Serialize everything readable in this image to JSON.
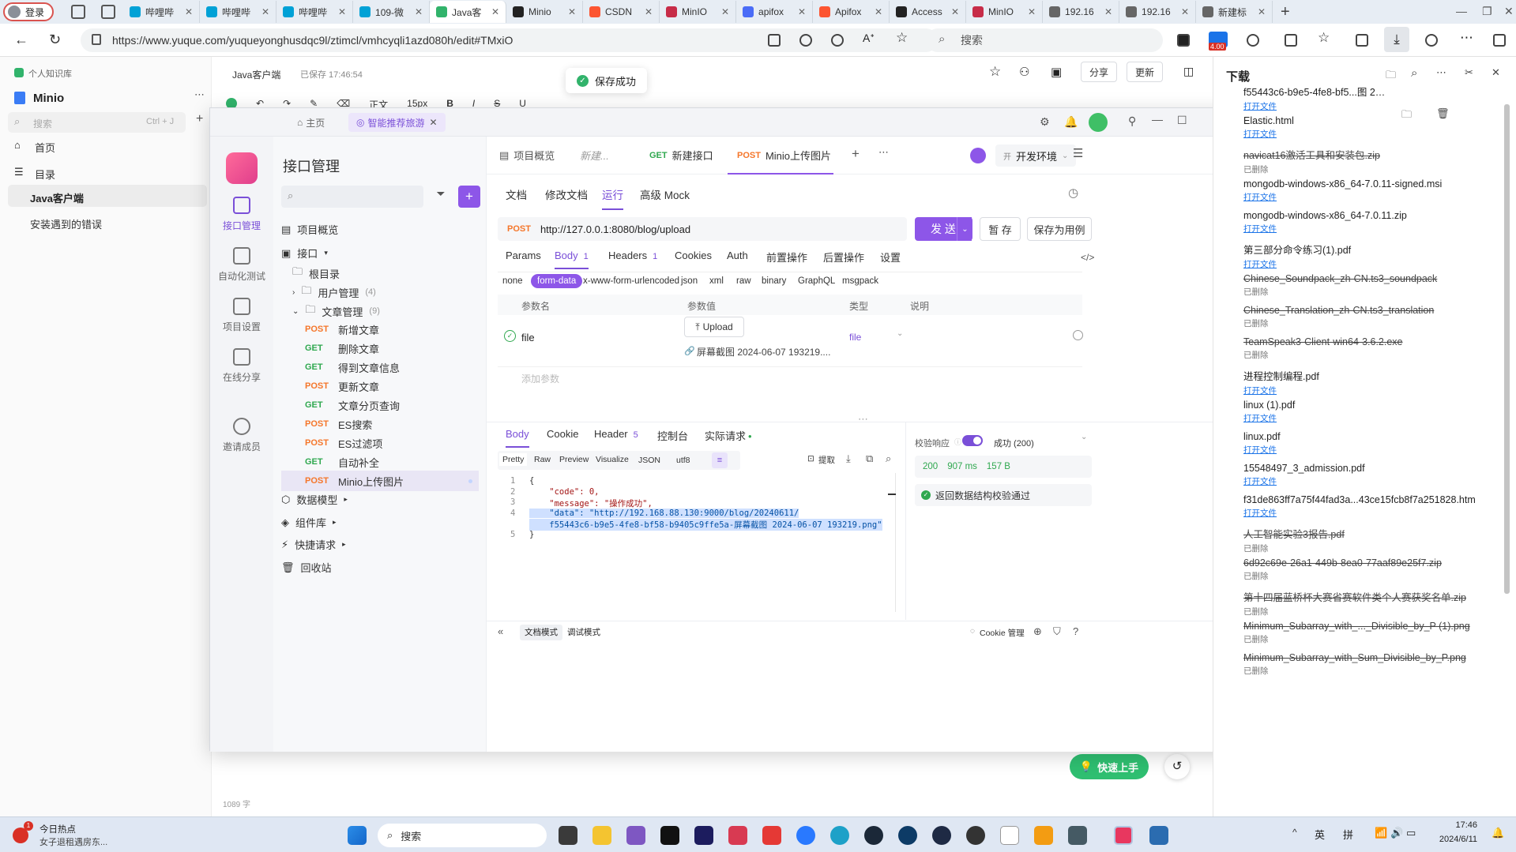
{
  "browser": {
    "login_label": "登录",
    "tabs": [
      {
        "label": "哔哩哔",
        "color": "#00a1d6",
        "active": false
      },
      {
        "label": "哔哩哔",
        "color": "#00a1d6",
        "active": false
      },
      {
        "label": "哔哩哔",
        "color": "#00a1d6",
        "active": false
      },
      {
        "label": "109-微",
        "color": "#00a1d6",
        "active": false
      },
      {
        "label": "Java客",
        "color": "#31b36b",
        "active": true
      },
      {
        "label": "Minio",
        "color": "#222222",
        "active": false
      },
      {
        "label": "CSDN",
        "color": "#fc5531",
        "active": false
      },
      {
        "label": "MinIO",
        "color": "#c72c48",
        "active": false
      },
      {
        "label": "apifox",
        "color": "#4a6cf7",
        "active": false
      },
      {
        "label": "Apifox",
        "color": "#fc5531",
        "active": false
      },
      {
        "label": "Access",
        "color": "#222222",
        "active": false
      },
      {
        "label": "MinIO",
        "color": "#c72c48",
        "active": false
      },
      {
        "label": "192.16",
        "color": "#666666",
        "active": false
      },
      {
        "label": "192.16",
        "color": "#666666",
        "active": false
      },
      {
        "label": "新建标",
        "color": "#666666",
        "active": false
      }
    ],
    "new_tab": "+",
    "url": "https://www.yuque.com/yuqueyonghusdqc9l/ztimcl/vmhcyqli1azd080h/edit#TMxiO",
    "search_placeholder": "搜索",
    "badge_value": "4.00"
  },
  "yuque": {
    "space_label": "个人知识库",
    "book_title": "Minio",
    "search_placeholder": "搜索",
    "search_shortcut": "Ctrl + J",
    "nav_home": "首页",
    "nav_toc": "目录",
    "doc_items": [
      "Java客户端",
      "安装遇到的错误"
    ],
    "doc_title": "Java客户端",
    "saved_status": "已保存 17:46:54",
    "toast": "保存成功",
    "share_button": "分享",
    "update_button": "更新",
    "word_count": "1089 字",
    "quick_start": "快速上手",
    "toolbar_text": "正文",
    "toolbar_size": "15px"
  },
  "apifox": {
    "tab_home": "主页",
    "tab_project": "智能推荐旅游",
    "rail": [
      "接口管理",
      "自动化测试",
      "项目设置",
      "在线分享",
      "邀请成员"
    ],
    "panel_title": "接口管理",
    "tree": {
      "overview": "项目概览",
      "interfaces": "接口",
      "root": "根目录",
      "folders": [
        {
          "name": "用户管理",
          "count": "(4)"
        },
        {
          "name": "文章管理",
          "count": "(9)"
        }
      ],
      "apis": [
        {
          "method": "POST",
          "name": "新增文章"
        },
        {
          "method": "GET",
          "name": "删除文章"
        },
        {
          "method": "GET",
          "name": "得到文章信息"
        },
        {
          "method": "POST",
          "name": "更新文章"
        },
        {
          "method": "GET",
          "name": "文章分页查询"
        },
        {
          "method": "POST",
          "name": "ES搜索"
        },
        {
          "method": "POST",
          "name": "ES过滤项"
        },
        {
          "method": "GET",
          "name": "自动补全"
        },
        {
          "method": "POST",
          "name": "Minio上传图片"
        }
      ],
      "bottom": [
        "数据模型",
        "组件库",
        "快捷请求",
        "回收站"
      ]
    },
    "top_tabs": [
      {
        "method": "",
        "label": "项目概览"
      },
      {
        "method": "",
        "label": "新建..."
      },
      {
        "method": "GET",
        "label": "新建接口"
      },
      {
        "method": "POST",
        "label": "Minio上传图片"
      }
    ],
    "env": "开发环境",
    "sub_tabs": [
      "文档",
      "修改文档",
      "运行",
      "高级 Mock"
    ],
    "request": {
      "method": "POST",
      "url": "http://127.0.0.1:8080/blog/upload",
      "send": "发 送",
      "save_temp": "暂 存",
      "save_case": "保存为用例"
    },
    "param_tabs": [
      {
        "label": "Params",
        "count": ""
      },
      {
        "label": "Body",
        "count": "1"
      },
      {
        "label": "Headers",
        "count": "1"
      },
      {
        "label": "Cookies",
        "count": ""
      },
      {
        "label": "Auth",
        "count": ""
      },
      {
        "label": "前置操作",
        "count": ""
      },
      {
        "label": "后置操作",
        "count": ""
      },
      {
        "label": "设置",
        "count": ""
      }
    ],
    "body_types": [
      "none",
      "form-data",
      "x-www-form-urlencoded",
      "json",
      "xml",
      "raw",
      "binary",
      "GraphQL",
      "msgpack"
    ],
    "table_headers": [
      "参数名",
      "参数值",
      "类型",
      "说明"
    ],
    "param": {
      "name": "file",
      "upload": "Upload",
      "file_name": "屏幕截图 2024-06-07 193219....",
      "type": "file"
    },
    "add_param": "添加参数",
    "resp_tabs": [
      {
        "label": "Body",
        "count": ""
      },
      {
        "label": "Cookie",
        "count": ""
      },
      {
        "label": "Header",
        "count": "5"
      },
      {
        "label": "控制台",
        "count": ""
      },
      {
        "label": "实际请求",
        "count": ""
      }
    ],
    "view_modes": [
      "Pretty",
      "Raw",
      "Preview",
      "Visualize"
    ],
    "format": "JSON",
    "encoding": "utf8",
    "extract": "提取",
    "code_lines": [
      {
        "no": "1",
        "text": "{"
      },
      {
        "no": "2",
        "text": "    \"code\": 0,"
      },
      {
        "no": "3",
        "text": "    \"message\": \"操作成功\","
      },
      {
        "no": "4",
        "text": "    \"data\": \"http://192.168.88.130:9000/blog/20240611/"
      },
      {
        "no": "",
        "text": "    f55443c6-b9e5-4fe8-bf58-b9405c9ffe5a-屏幕截图 2024-06-07 193219.png\""
      },
      {
        "no": "5",
        "text": "}"
      }
    ],
    "validate_label": "校验响应",
    "success_label": "成功 (200)",
    "status_code": "200",
    "time": "907 ms",
    "size": "157 B",
    "validate_pass": "返回数据结构校验通过",
    "doc_mode": "文档模式",
    "debug_mode": "调试模式",
    "cookie_mgmt": "Cookie 管理"
  },
  "downloads": {
    "title": "下载",
    "items": [
      {
        "name": "f55443c6-b9e5-4fe8-bf5...图 2024-06-07",
        "status": "打开文件",
        "deleted": false
      },
      {
        "name": "Elastic.html",
        "status": "打开文件",
        "deleted": false
      },
      {
        "name": "navicat16激活工具和安装包.zip",
        "status": "已删除",
        "deleted": true
      },
      {
        "name": "mongodb-windows-x86_64-7.0.11-signed.msi",
        "status": "打开文件",
        "deleted": false
      },
      {
        "name": "mongodb-windows-x86_64-7.0.11.zip",
        "status": "打开文件",
        "deleted": false
      },
      {
        "name": "第三部分命令练习(1).pdf",
        "status": "打开文件",
        "deleted": false
      },
      {
        "name": "Chinese_Soundpack_zh-CN.ts3_soundpack",
        "status": "已删除",
        "deleted": true
      },
      {
        "name": "Chinese_Translation_zh-CN.ts3_translation",
        "status": "已删除",
        "deleted": true
      },
      {
        "name": "TeamSpeak3-Client-win64-3.6.2.exe",
        "status": "已删除",
        "deleted": true
      },
      {
        "name": "进程控制编程.pdf",
        "status": "打开文件",
        "deleted": false
      },
      {
        "name": "linux (1).pdf",
        "status": "打开文件",
        "deleted": false
      },
      {
        "name": "linux.pdf",
        "status": "打开文件",
        "deleted": false
      },
      {
        "name": "15548497_3_admission.pdf",
        "status": "打开文件",
        "deleted": false
      },
      {
        "name": "f31de863ff7a75f44fad3a...43ce15fcb8f7a251828.htm",
        "status": "打开文件",
        "deleted": false
      },
      {
        "name": "人工智能实验3报告.pdf",
        "status": "已删除",
        "deleted": true
      },
      {
        "name": "6d92c69e-26a1-449b-8ea0-77aaf89e25f7.zip",
        "status": "已删除",
        "deleted": true
      },
      {
        "name": "第十四届蓝桥杯大赛省赛软件类个人赛获奖名单.zip",
        "status": "已删除",
        "deleted": true
      },
      {
        "name": "Minimum_Subarray_with_..._Divisible_by_P (1).png",
        "status": "已删除",
        "deleted": true
      },
      {
        "name": "Minimum_Subarray_with_Sum_Divisible_by_P.png",
        "status": "已删除",
        "deleted": true
      }
    ]
  },
  "taskbar": {
    "news_title": "今日热点",
    "news_text": "女子退租遇房东...",
    "news_badge": "1",
    "search": "搜索",
    "ime_lang": "英",
    "ime_mode": "拼",
    "time": "17:46",
    "date": "2024/6/11"
  }
}
